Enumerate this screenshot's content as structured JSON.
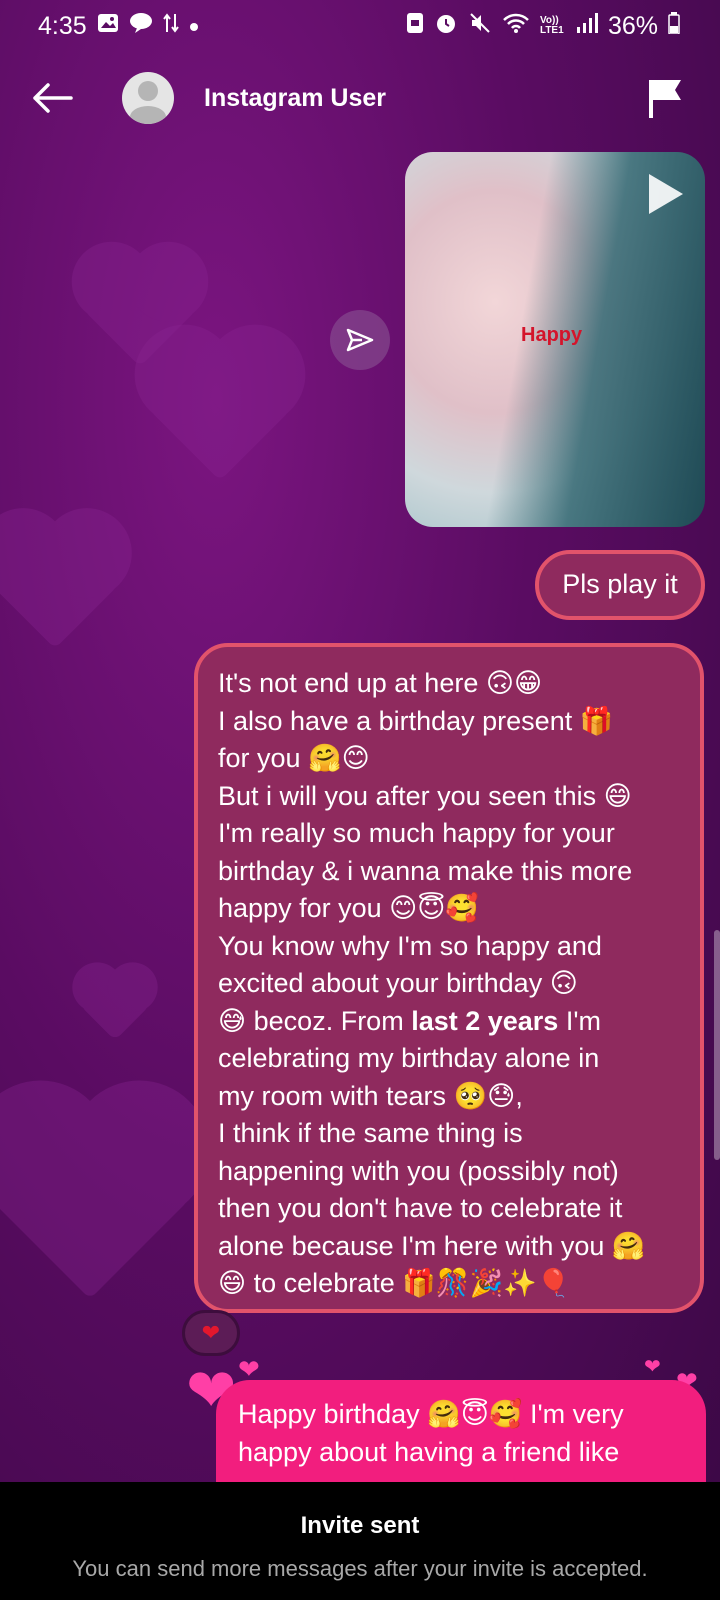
{
  "status_bar": {
    "time": "4:35",
    "left_icons": [
      "gallery-icon",
      "chat-icon",
      "data-transfer-icon",
      "dot-icon"
    ],
    "network_label": "Vo)) LTE1",
    "battery": "36%"
  },
  "header": {
    "title": "Instagram User"
  },
  "media": {
    "caption": "Happy"
  },
  "messages": {
    "short": "Pls play it",
    "long_lines": [
      "It's not end up at here 🙃😁",
      "I also have a birthday present 🎁",
      "for you 🤗😊",
      "But i will you after you seen this 😄",
      "I'm really so much happy for your",
      "birthday & i wanna make this more",
      "happy for you 😊😇🥰",
      "You know why I'm so happy and",
      "excited about your birthday 🙃",
      "😅 becoz. From ",
      "celebrating my birthday alone in",
      "my room with tears 🥺😓,",
      "I think if the same thing is",
      "happening with you (possibly not)",
      "then you don't have to celebrate it",
      "alone because I'm here with you 🤗",
      "😄 to celebrate 🎁🎊🎉✨🎈"
    ],
    "long_bold": "last 2 years",
    "long_after_bold": " I'm",
    "reaction": "❤",
    "pink_lines": [
      "Happy birthday 🤗😇🥰 I'm very",
      "happy about having a friend like"
    ]
  },
  "footer": {
    "title": "Invite sent",
    "subtitle": "You can send more messages after your invite is accepted."
  },
  "colors": {
    "background": "#5a0c62",
    "bubble_outlined_fill": "#8f2a5e",
    "bubble_outlined_border": "#e2536b",
    "bubble_pink": "#f21e7e",
    "footer": "#000000"
  }
}
